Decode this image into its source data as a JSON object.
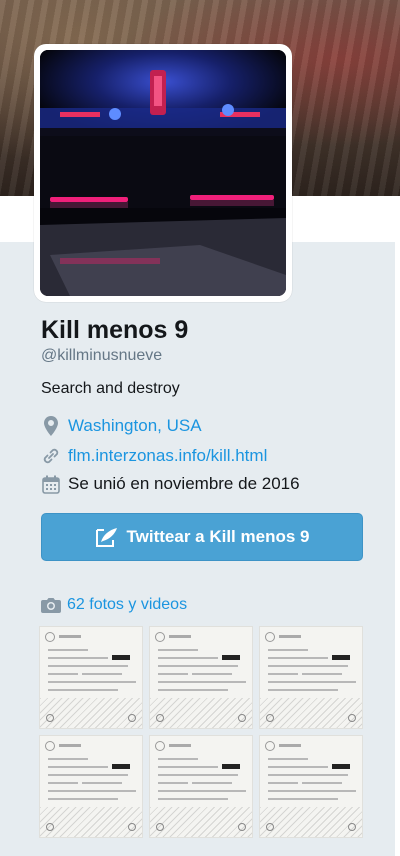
{
  "profile": {
    "name": "Kill menos 9",
    "handle": "@killminusnueve",
    "bio": "Search and destroy",
    "location": "Washington, USA",
    "location_icon": "location-pin-icon",
    "url": "flm.interzonas.info/kill.html",
    "url_icon": "link-icon",
    "joined": "Se unió en noviembre de 2016",
    "joined_icon": "calendar-icon"
  },
  "actions": {
    "tweet_to_label": "Twittear a Kill menos 9",
    "tweet_to_icon": "compose-tweet-icon"
  },
  "media": {
    "photos_label": "62 fotos y videos",
    "photos_icon": "camera-icon",
    "thumbnails": [
      "document-scan",
      "document-scan",
      "document-scan",
      "document-scan",
      "document-scan",
      "document-scan"
    ]
  },
  "colors": {
    "link": "#1b95e0",
    "button": "#4aa2d4",
    "background": "#e6ecf0"
  }
}
